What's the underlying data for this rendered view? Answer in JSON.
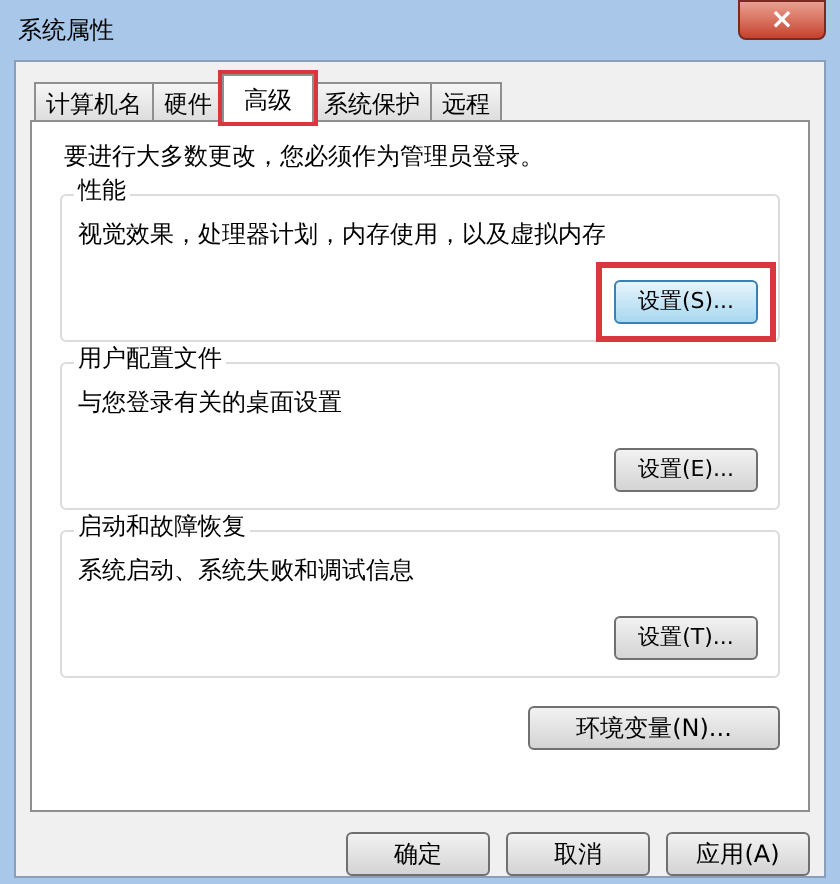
{
  "window": {
    "title": "系统属性",
    "close": "×"
  },
  "tabs": [
    {
      "label": "计算机名",
      "selected": false,
      "highlighted": false
    },
    {
      "label": "硬件",
      "selected": false,
      "highlighted": false
    },
    {
      "label": "高级",
      "selected": true,
      "highlighted": true
    },
    {
      "label": "系统保护",
      "selected": false,
      "highlighted": false
    },
    {
      "label": "远程",
      "selected": false,
      "highlighted": false
    }
  ],
  "notice": "要进行大多数更改，您必须作为管理员登录。",
  "groups": [
    {
      "title": "性能",
      "description": "视觉效果，处理器计划，内存使用，以及虚拟内存",
      "button": {
        "label": "设置(S)...",
        "highlighted": true,
        "focused": true
      }
    },
    {
      "title": "用户配置文件",
      "description": "与您登录有关的桌面设置",
      "button": {
        "label": "设置(E)...",
        "highlighted": false,
        "focused": false
      }
    },
    {
      "title": "启动和故障恢复",
      "description": "系统启动、系统失败和调试信息",
      "button": {
        "label": "设置(T)...",
        "highlighted": false,
        "focused": false
      }
    }
  ],
  "environment_button": "环境变量(N)...",
  "dialog_buttons": [
    "确定",
    "取消",
    "应用(A)"
  ]
}
